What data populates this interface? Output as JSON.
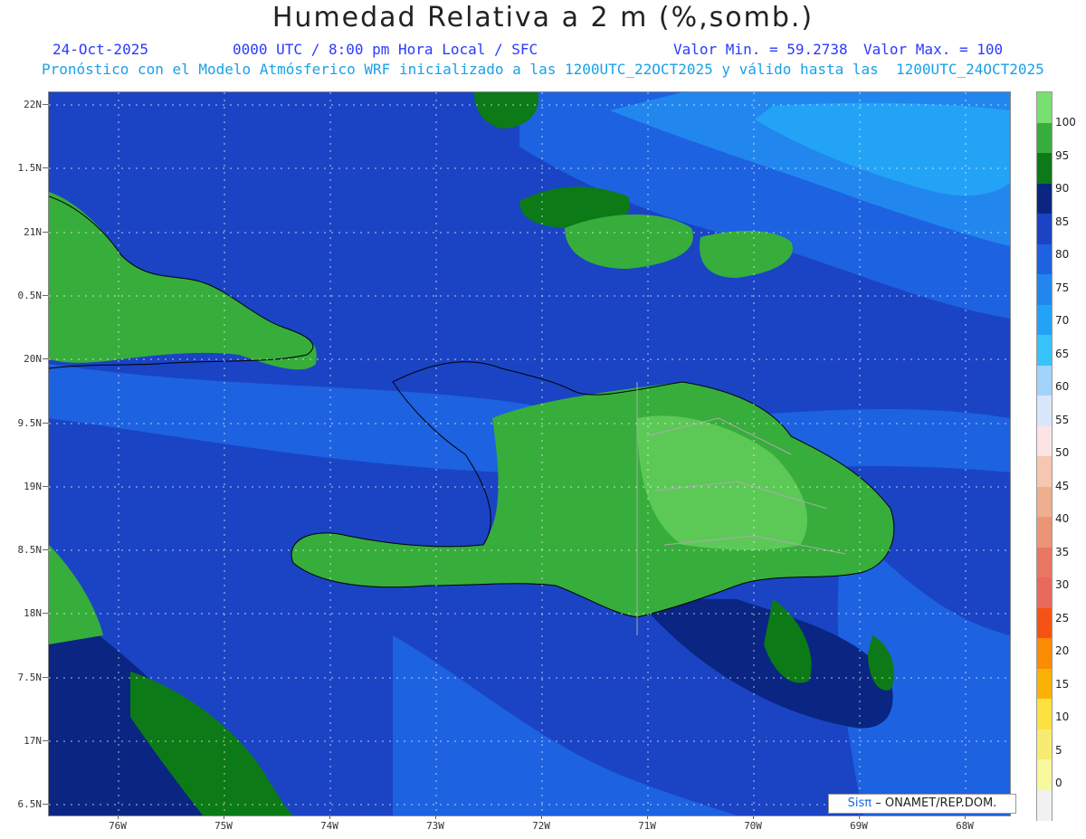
{
  "title": "Humedad Relativa a 2 m (%,somb.)",
  "date": "24-Oct-2025",
  "time_line": "0000 UTC / 8:00 pm Hora Local / SFC",
  "min_label": "Valor Min. = 59.2738",
  "max_label": "Valor Max. = 100",
  "forecast_line": "Pronóstico con el Modelo Atmósferico WRF inicializado a las 1200UTC_22OCT2025 y válido hasta las  1200UTC_24OCT2025",
  "credit_brand": "Sisπ",
  "credit_text": "– ONAMET/REP.DOM.",
  "lat_labels": [
    "22N",
    "1.5N",
    "21N",
    "0.5N",
    "20N",
    "9.5N",
    "19N",
    "8.5N",
    "18N",
    "7.5N",
    "17N",
    "6.5N"
  ],
  "lon_labels": [
    "76W",
    "75W",
    "74W",
    "73W",
    "72W",
    "71W",
    "70W",
    "69W",
    "68W"
  ],
  "legend_labels": [
    "100",
    "95",
    "90",
    "85",
    "80",
    "75",
    "70",
    "65",
    "60",
    "55",
    "50",
    "45",
    "40",
    "35",
    "30",
    "25",
    "20",
    "15",
    "10",
    "5",
    "0"
  ],
  "legend_colors": [
    "#78e06e",
    "#37ad3c",
    "#0c7a17",
    "#0a2582",
    "#1a44c4",
    "#1d62e0",
    "#2187ee",
    "#23a3f5",
    "#38c2fb",
    "#a2d3fb",
    "#d9e6fc",
    "#fde4e4",
    "#f6c6b0",
    "#efaf8e",
    "#ec9575",
    "#e97762",
    "#e86a5b",
    "#f75216",
    "#fc8b06",
    "#fcb106",
    "#fde140",
    "#f7ec72",
    "#f8f89c",
    "#f1f1f1"
  ]
}
